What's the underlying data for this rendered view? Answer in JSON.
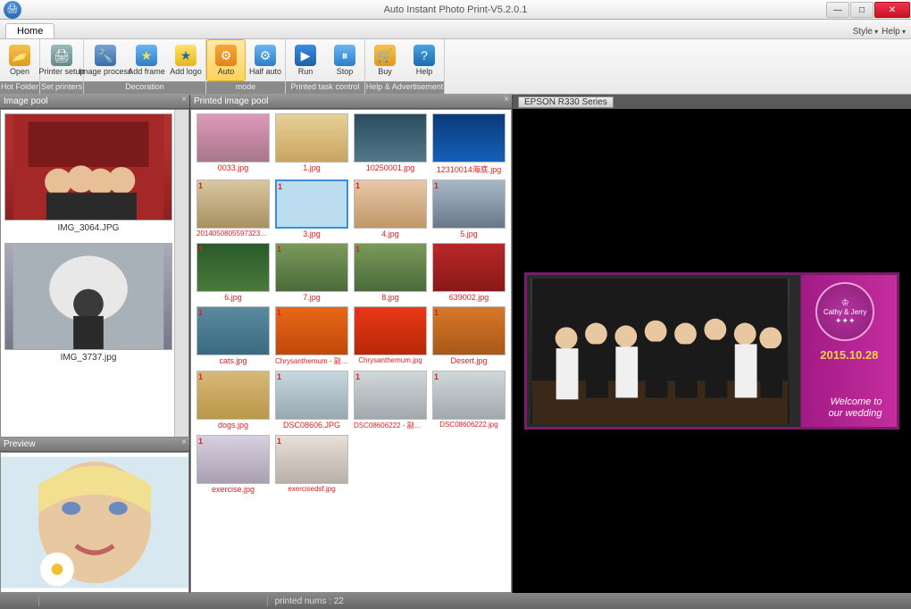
{
  "title": "Auto Instant Photo Print-V5.2.0.1",
  "tabs": {
    "home": "Home"
  },
  "menu": {
    "style": "Style",
    "help": "Help"
  },
  "ribbon": {
    "groups": [
      {
        "label": "Hot Folder",
        "buttons": [
          {
            "name": "open",
            "text": "Open"
          }
        ]
      },
      {
        "label": "Set printers",
        "buttons": [
          {
            "name": "printer-setup",
            "text": "Printer setup"
          }
        ]
      },
      {
        "label": "Decoration",
        "buttons": [
          {
            "name": "image-process",
            "text": "Image process"
          },
          {
            "name": "add-frame",
            "text": "Add frame"
          },
          {
            "name": "add-logo",
            "text": "Add logo"
          }
        ]
      },
      {
        "label": "mode",
        "buttons": [
          {
            "name": "auto",
            "text": "Auto"
          },
          {
            "name": "half-auto",
            "text": "Half auto"
          }
        ]
      },
      {
        "label": "Printed task control",
        "buttons": [
          {
            "name": "run",
            "text": "Run"
          },
          {
            "name": "stop",
            "text": "Stop"
          }
        ]
      },
      {
        "label": "Help & Advertisement",
        "buttons": [
          {
            "name": "buy",
            "text": "Buy"
          },
          {
            "name": "help",
            "text": "Help"
          }
        ]
      }
    ]
  },
  "panels": {
    "imagePool": "Image pool",
    "printedPool": "Printed image pool",
    "preview": "Preview",
    "printer": "EPSON R330 Series"
  },
  "imagePool": [
    {
      "caption": "IMG_3064.JPG"
    },
    {
      "caption": "IMG_3737.jpg"
    }
  ],
  "printedPool": [
    {
      "caption": "0033.jpg",
      "cls": "ph-portrait"
    },
    {
      "caption": "1.jpg",
      "cls": "ph-blonde"
    },
    {
      "caption": "10250001.jpg",
      "cls": "ph-penguin"
    },
    {
      "caption": "12310014海底.jpg",
      "cls": "ph-underwater"
    },
    {
      "caption": "20140508055973237 - ...",
      "cls": "ph-couple",
      "badge": "1"
    },
    {
      "caption": "3.jpg",
      "cls": "ph-face",
      "badge": "1",
      "selected": true
    },
    {
      "caption": "4.jpg",
      "cls": "ph-face",
      "badge": "1"
    },
    {
      "caption": "5.jpg",
      "cls": "ph-group",
      "badge": "1"
    },
    {
      "caption": "6.jpg",
      "cls": "ph-forest",
      "badge": "1"
    },
    {
      "caption": "7.jpg",
      "cls": "ph-kiss",
      "badge": "1"
    },
    {
      "caption": "8.jpg",
      "cls": "ph-kiss",
      "badge": "1"
    },
    {
      "caption": "639002.jpg",
      "cls": "ph-flowers",
      "badge": "1"
    },
    {
      "caption": "cats.jpg",
      "cls": "ph-cats",
      "badge": "1"
    },
    {
      "caption": "Chrysanthemum - 副本.j...",
      "cls": "ph-orange",
      "badge": "1"
    },
    {
      "caption": "Chrysanthemum.jpg",
      "cls": "ph-mum",
      "badge": "1"
    },
    {
      "caption": "Desert.jpg",
      "cls": "ph-desert",
      "badge": "1"
    },
    {
      "caption": "dogs.jpg",
      "cls": "ph-dogs",
      "badge": "1"
    },
    {
      "caption": "DSC08606.JPG",
      "cls": "ph-man1",
      "badge": "1"
    },
    {
      "caption": "DSC08606222 - 副本.jpg",
      "cls": "ph-man2",
      "badge": "1"
    },
    {
      "caption": "DSC08606222.jpg",
      "cls": "ph-man2",
      "badge": "1"
    },
    {
      "caption": "exercise.jpg",
      "cls": "ph-exercise",
      "badge": "1"
    },
    {
      "caption": "exercisedsf.jpg",
      "cls": "ph-wedding2",
      "badge": "1"
    }
  ],
  "output": {
    "names": "Cathy & Jerry",
    "date": "2015.10.28",
    "welcomeLine1": "Welcome to",
    "welcomeLine2": "our wedding"
  },
  "status": {
    "printed": "printed nums : 22"
  }
}
